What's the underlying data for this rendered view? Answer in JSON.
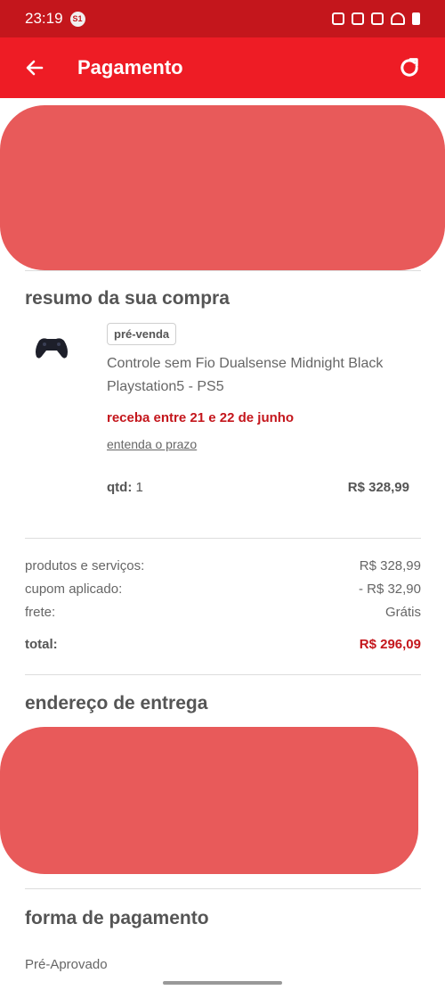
{
  "status_bar": {
    "time": "23:19",
    "badge": "S1"
  },
  "app_bar": {
    "title": "Pagamento"
  },
  "summary": {
    "title": "resumo da sua compra",
    "badge": "pré-venda",
    "product_name": "Controle sem Fio Dualsense Midnight Black Playstation5 - PS5",
    "delivery": "receba entre 21 e 22 de junho",
    "delivery_link": "entenda o prazo",
    "qty_label": "qtd:",
    "qty_value": "1",
    "item_price": "R$ 328,99"
  },
  "totals": {
    "products_label": "produtos e serviços:",
    "products_value": "R$ 328,99",
    "coupon_label": "cupom aplicado:",
    "coupon_value": "- R$ 32,90",
    "shipping_label": "frete:",
    "shipping_value": "Grátis",
    "total_label": "total:",
    "total_value": "R$ 296,09"
  },
  "address": {
    "title": "endereço de entrega"
  },
  "payment": {
    "title": "forma de pagamento",
    "method": "Pré-Aprovado"
  },
  "colors": {
    "brand_red": "#ee1c25",
    "status_red": "#c4161c",
    "scribble": "#e85a5a"
  }
}
